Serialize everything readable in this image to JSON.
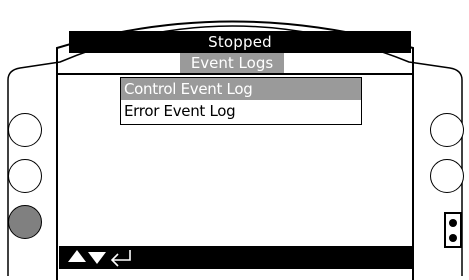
{
  "header": {
    "status": "Stopped",
    "menu_title": "Event Logs"
  },
  "menu": {
    "items": [
      {
        "label": "Control Event Log",
        "selected": true
      },
      {
        "label": "Error Event Log",
        "selected": false
      }
    ]
  },
  "softkeys": {
    "icons": [
      "up-arrow",
      "down-arrow",
      "enter-arrow"
    ]
  },
  "colors": {
    "bar_background": "#000000",
    "highlight": "#9a9a9a",
    "active_button": "#808080"
  }
}
